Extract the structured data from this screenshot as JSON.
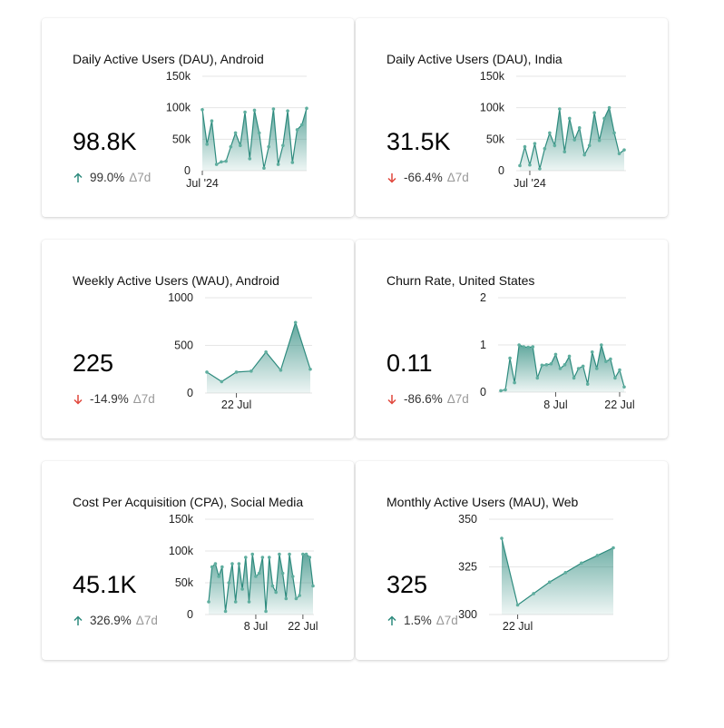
{
  "colors": {
    "accent": "#2e8b7e",
    "down": "#e0473c",
    "grid": "#e6e6e6",
    "axis": "#555555"
  },
  "cards": [
    {
      "title": "Daily Active Users (DAU), Android",
      "value": "98.8K",
      "delta": {
        "direction": "up",
        "icon": "arrow-up-icon",
        "pct": "99.0%",
        "period": "Δ7d"
      },
      "chart_data": {
        "type": "area",
        "yticks": [
          "150k",
          "100k",
          "50k",
          "0"
        ],
        "ylim": [
          0,
          150000
        ],
        "xticks": [
          {
            "label": "Jul '24",
            "index": 0
          }
        ],
        "values": [
          97000,
          42000,
          79000,
          10000,
          14000,
          15000,
          38000,
          60000,
          40000,
          93000,
          19000,
          96000,
          60000,
          4000,
          38000,
          98000,
          10000,
          40000,
          95000,
          13000,
          65000,
          73000,
          99000
        ]
      }
    },
    {
      "title": "Daily Active Users (DAU), India",
      "value": "31.5K",
      "delta": {
        "direction": "down",
        "icon": "arrow-down-icon",
        "pct": "-66.4%",
        "period": "Δ7d"
      },
      "chart_data": {
        "type": "area",
        "yticks": [
          "150k",
          "100k",
          "50k",
          "0"
        ],
        "ylim": [
          0,
          150000
        ],
        "xticks": [
          {
            "label": "Jul '24",
            "index": 2
          }
        ],
        "values": [
          8000,
          38000,
          9000,
          43000,
          3000,
          35000,
          60000,
          40000,
          98000,
          30000,
          83000,
          49000,
          68000,
          25000,
          40000,
          92000,
          48000,
          83000,
          100000,
          60000,
          27000,
          33000
        ]
      }
    },
    {
      "title": "Weekly Active Users (WAU), Android",
      "value": "225",
      "delta": {
        "direction": "down",
        "icon": "arrow-down-icon",
        "pct": "-14.9%",
        "period": "Δ7d"
      },
      "chart_data": {
        "type": "area",
        "yticks": [
          "1000",
          "500",
          "0"
        ],
        "ylim": [
          0,
          1000
        ],
        "xticks": [
          {
            "label": "22 Jul",
            "index": 2
          }
        ],
        "values": [
          220,
          120,
          220,
          230,
          430,
          240,
          740,
          250
        ]
      }
    },
    {
      "title": "Churn Rate, United States",
      "value": "0.11",
      "delta": {
        "direction": "down",
        "icon": "arrow-down-icon",
        "pct": "-86.6%",
        "period": "Δ7d"
      },
      "chart_data": {
        "type": "area",
        "yticks": [
          "2",
          "1",
          "0"
        ],
        "ylim": [
          0,
          2
        ],
        "xticks": [
          {
            "label": "8 Jul",
            "index": 12
          },
          {
            "label": "22 Jul",
            "index": 26
          }
        ],
        "values": [
          0.03,
          0.05,
          0.72,
          0.2,
          1.0,
          0.96,
          0.95,
          0.96,
          0.3,
          0.57,
          0.58,
          0.6,
          0.8,
          0.5,
          0.58,
          0.76,
          0.3,
          0.5,
          0.55,
          0.17,
          0.85,
          0.5,
          1.0,
          0.65,
          0.7,
          0.3,
          0.47,
          0.11
        ]
      }
    },
    {
      "title": "Cost Per Acquisition (CPA), Social Media",
      "value": "45.1K",
      "delta": {
        "direction": "up",
        "icon": "arrow-up-icon",
        "pct": "326.9%",
        "period": "Δ7d"
      },
      "chart_data": {
        "type": "area",
        "yticks": [
          "150k",
          "100k",
          "50k",
          "0"
        ],
        "ylim": [
          0,
          150000
        ],
        "xticks": [
          {
            "label": "8 Jul",
            "index": 14
          },
          {
            "label": "22 Jul",
            "index": 28
          }
        ],
        "values": [
          20000,
          75000,
          80000,
          60000,
          75000,
          5000,
          50000,
          80000,
          20000,
          80000,
          40000,
          90000,
          20000,
          95000,
          60000,
          65000,
          90000,
          5000,
          90000,
          45000,
          35000,
          95000,
          65000,
          25000,
          95000,
          60000,
          25000,
          30000,
          95000,
          95000,
          90000,
          45000
        ]
      }
    },
    {
      "title": "Monthly Active Users (MAU), Web",
      "value": "325",
      "delta": {
        "direction": "up",
        "icon": "arrow-up-icon",
        "pct": "1.5%",
        "period": "Δ7d"
      },
      "chart_data": {
        "type": "area",
        "yticks": [
          "350",
          "325",
          "300"
        ],
        "ylim": [
          300,
          350
        ],
        "xticks": [
          {
            "label": "22 Jul",
            "index": 1
          }
        ],
        "values": [
          340,
          305,
          311,
          317,
          322,
          327,
          331,
          335
        ]
      }
    }
  ]
}
